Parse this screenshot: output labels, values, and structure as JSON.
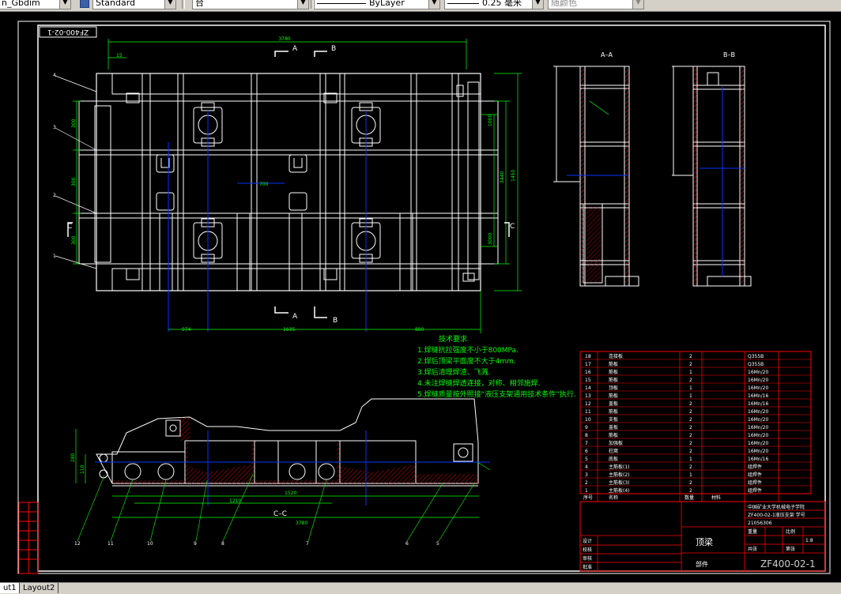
{
  "toolbar": {
    "dimstyle_value": "n_Gbdim",
    "textstyle_value": "Standard",
    "layer_value": "台",
    "linetype_value": "ByLayer",
    "lineweight_value": "0.25 毫米",
    "color_value": "随颜色"
  },
  "layout_tabs": [
    "ut1",
    "Layout2"
  ],
  "drawing": {
    "header_code": "ZF400-02-1",
    "section_marks": {
      "a": "A",
      "b": "B",
      "c": "C",
      "aa": "A–A",
      "bb": "B–B",
      "cc": "C–C"
    },
    "tech_requirements": {
      "title": "技术要求",
      "items": [
        "1.焊缝抗拉强度不小于800MPa.",
        "2.焊后顶梁平面度不大于4mm.",
        "3.焊后清理焊渣、飞溅.",
        "4.未注焊缝焊透连接，对称、相邻施焊.",
        "5.焊缝质量按外照接“液压支架通用技术条件”执行."
      ]
    },
    "dimensions": {
      "top_overall": "3780",
      "top_left": "15",
      "bottom_left": "974",
      "bottom_middle": "1635",
      "bottom_right": "880",
      "right_overall": "1450",
      "right_inner": "3440",
      "right_half_upper": "1000",
      "right_half_lower": "3000",
      "left_spacing_1": "300",
      "left_spacing_2": "300",
      "left_spacing_3": "300",
      "center_spacing": "700",
      "cc_overall": "3780",
      "cc_inner": "1520",
      "cc_lower": "1210",
      "cc_height": "280",
      "cc_left_h": "110"
    },
    "parts_list": {
      "rows": [
        {
          "no": "18",
          "name": "连接板",
          "qty": "2",
          "mat": "Q355B"
        },
        {
          "no": "17",
          "name": "筋板",
          "qty": "2",
          "mat": "Q355B"
        },
        {
          "no": "16",
          "name": "筋板",
          "qty": "1",
          "mat": "16Mn/20"
        },
        {
          "no": "15",
          "name": "筋板",
          "qty": "2",
          "mat": "16Mn/20"
        },
        {
          "no": "14",
          "name": "顶板",
          "qty": "1",
          "mat": "16Mn/20"
        },
        {
          "no": "13",
          "name": "筋板",
          "qty": "1",
          "mat": "16Mn/16"
        },
        {
          "no": "12",
          "name": "盖板",
          "qty": "2",
          "mat": "16Mn/16"
        },
        {
          "no": "11",
          "name": "筋板",
          "qty": "2",
          "mat": "16Mn/20"
        },
        {
          "no": "10",
          "name": "支板",
          "qty": "2",
          "mat": "16Mn/20"
        },
        {
          "no": "9",
          "name": "盖板",
          "qty": "2",
          "mat": "16Mn/20"
        },
        {
          "no": "8",
          "name": "筋板",
          "qty": "2",
          "mat": "16Mn/20"
        },
        {
          "no": "7",
          "name": "加强板",
          "qty": "2",
          "mat": "16Mn/20"
        },
        {
          "no": "6",
          "name": "柱窝",
          "qty": "2",
          "mat": "16Mn/20"
        },
        {
          "no": "5",
          "name": "底板",
          "qty": "1",
          "mat": "16Mn/16"
        },
        {
          "no": "4",
          "name": "主筋板(1)",
          "qty": "2",
          "mat": "组焊件"
        },
        {
          "no": "3",
          "name": "主筋板(2)",
          "qty": "1",
          "mat": "组焊件"
        },
        {
          "no": "2",
          "name": "主筋板(3)",
          "qty": "2",
          "mat": "组焊件"
        },
        {
          "no": "1",
          "name": "主筋板(4)",
          "qty": "2",
          "mat": "组焊件"
        }
      ],
      "headers": [
        "序号",
        "名称",
        "数量",
        "材料"
      ]
    },
    "title_block": {
      "school": "中国矿业大学机械电子学院",
      "project": "ZF400-02-1液压支架 学号",
      "code": "21056306",
      "part_name": "顶梁",
      "drawing_no": "ZF400-02-1",
      "scale": "1:8",
      "assembly_label": "部件",
      "row_labels": [
        "设计",
        "校核",
        "审核",
        "批准"
      ],
      "grid_labels": [
        "重量",
        "比例",
        "共张",
        "第张"
      ]
    }
  }
}
